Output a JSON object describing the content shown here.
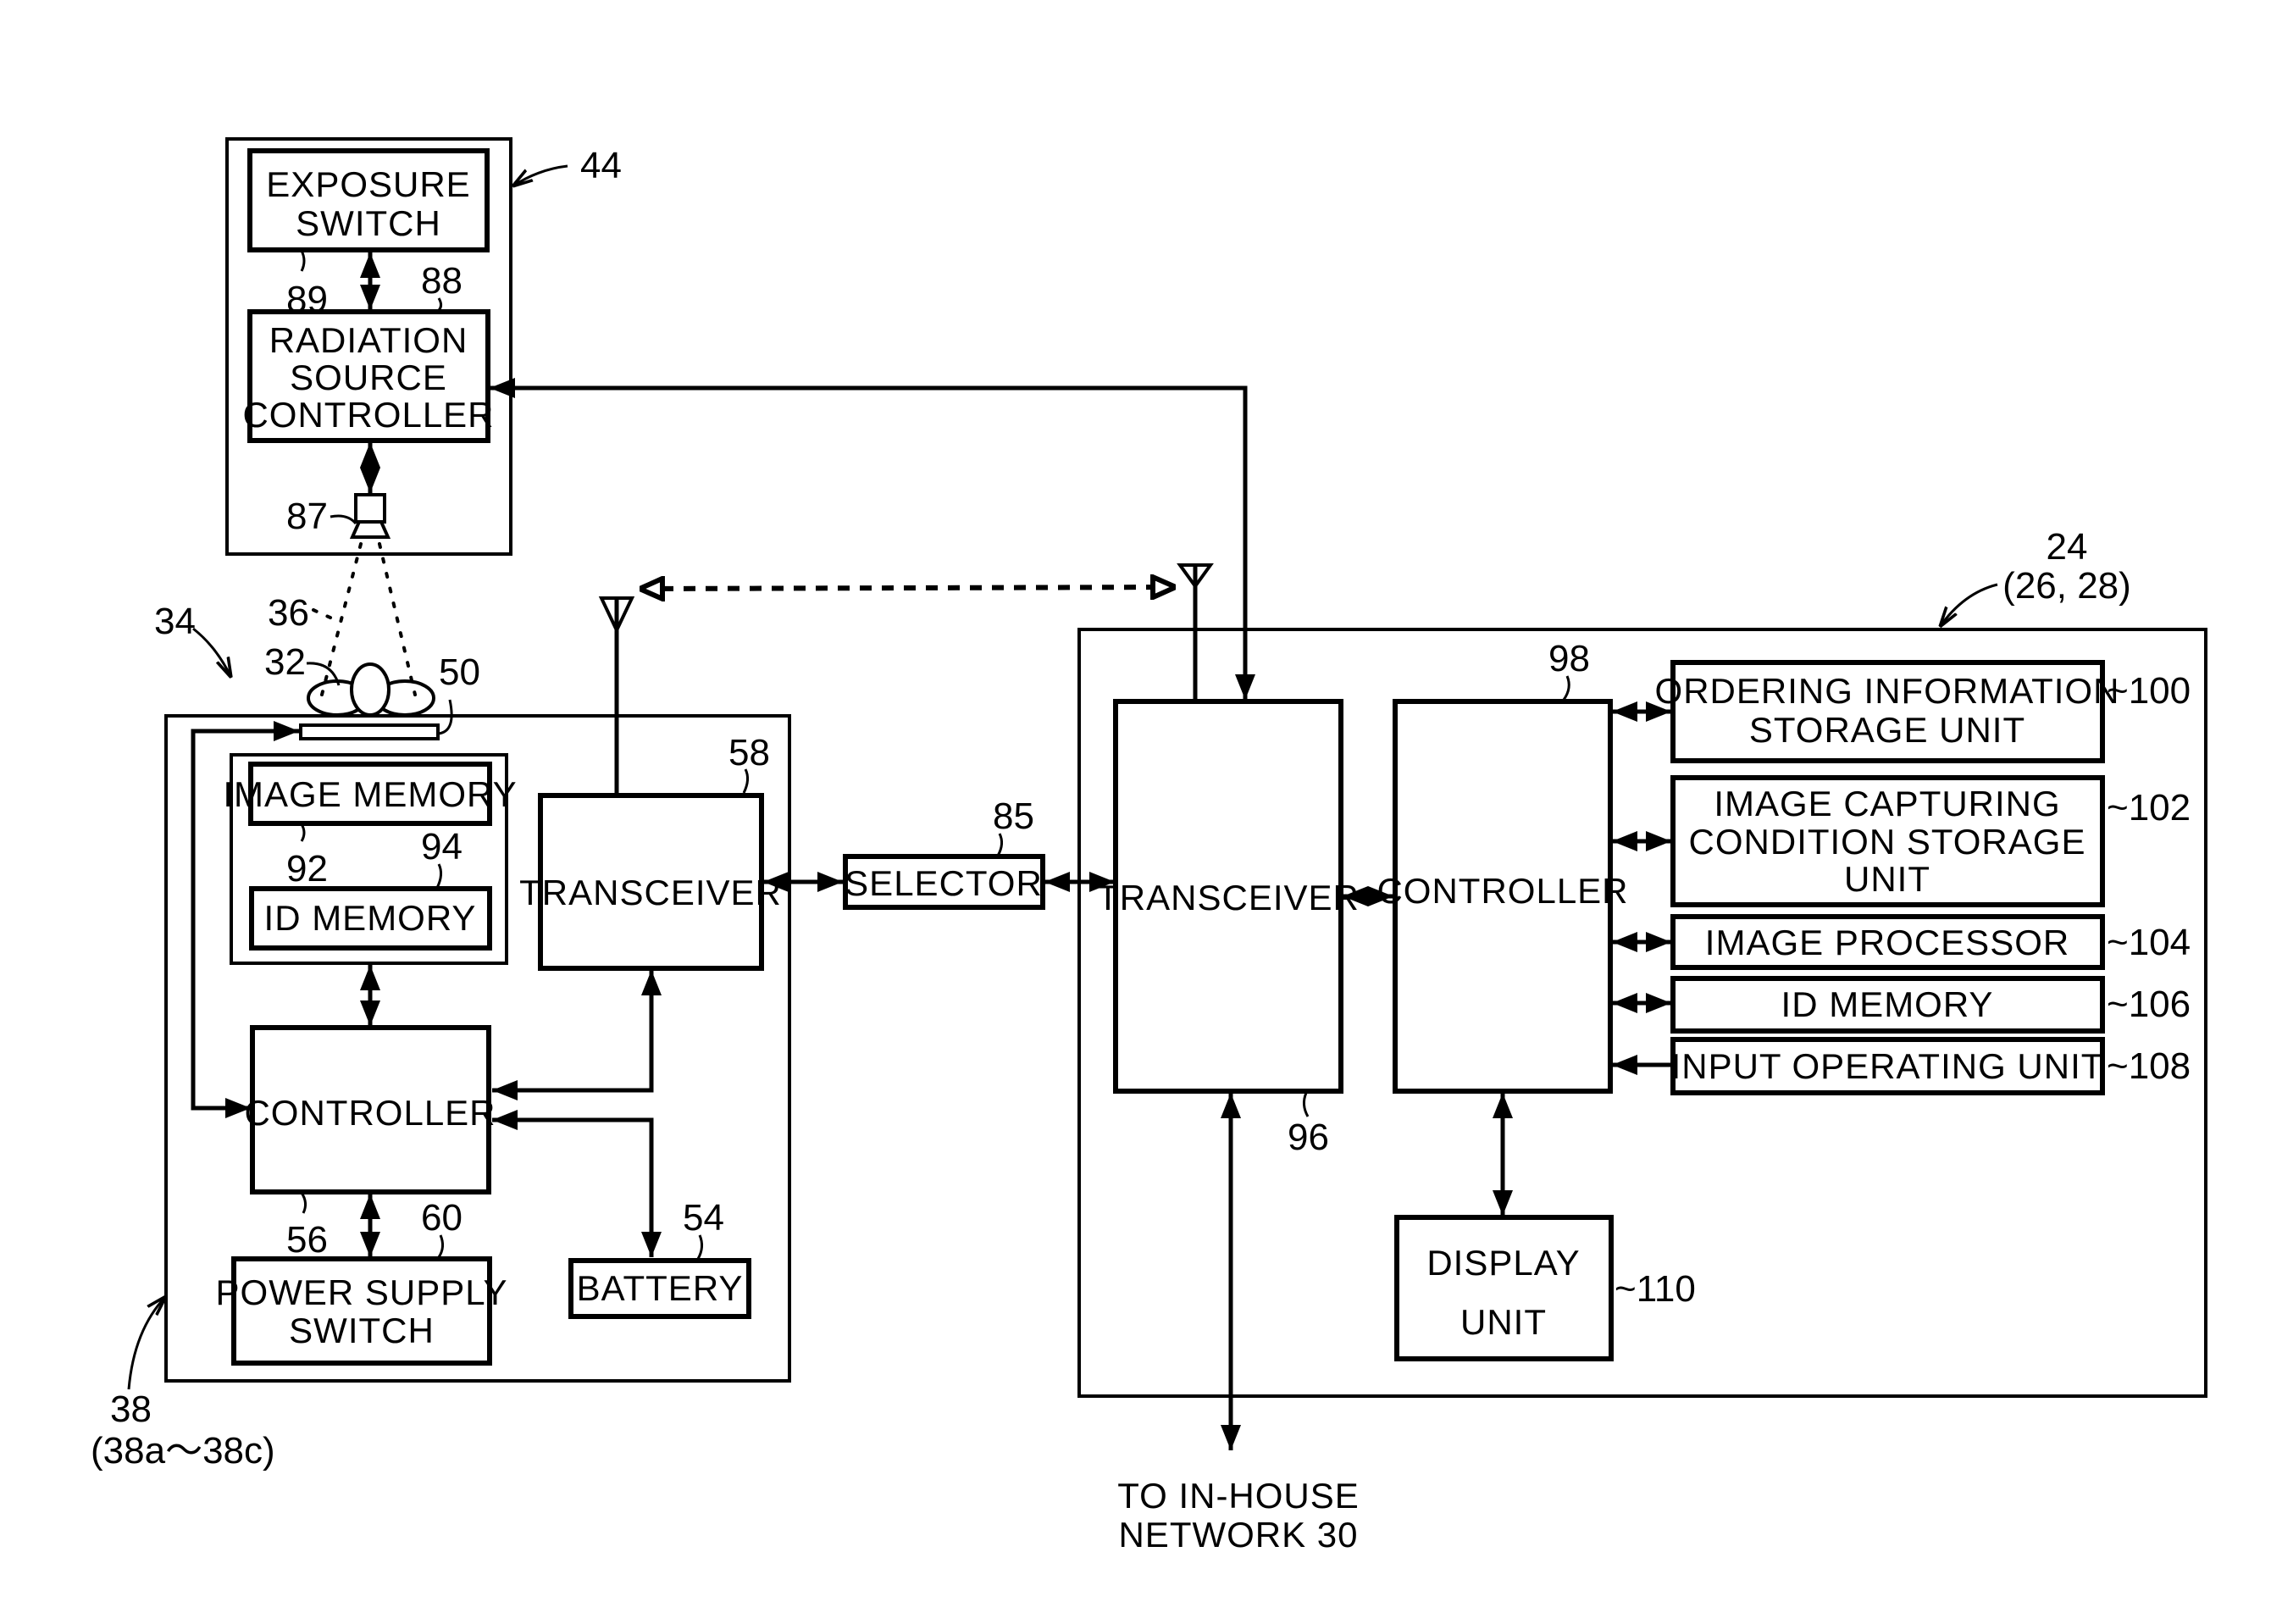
{
  "figure": {
    "colors": {
      "ink": "#000000",
      "paper": "#ffffff"
    },
    "source_unit": {
      "ref": "44",
      "exposure_switch": {
        "lines": [
          "EXPOSURE",
          "SWITCH"
        ],
        "ref": "89"
      },
      "radiation_source_controller": {
        "lines": [
          "RADIATION",
          "SOURCE",
          "CONTROLLER"
        ],
        "ref": "88"
      },
      "radiation_source": {
        "ref": "87"
      }
    },
    "scene": {
      "system_ref": "34",
      "radiation_ref": "36",
      "subject_ref": "32",
      "detector_ref": "50"
    },
    "cassette": {
      "ref": "38",
      "ref_sub": "(38a～38c)",
      "image_memory": {
        "label": "IMAGE MEMORY",
        "ref": "92"
      },
      "id_memory": {
        "label": "ID MEMORY",
        "ref": "94"
      },
      "transceiver": {
        "label": "TRANSCEIVER",
        "ref": "58"
      },
      "controller": {
        "label": "CONTROLLER",
        "ref": "56"
      },
      "power_supply_switch": {
        "lines": [
          "POWER SUPPLY",
          "SWITCH"
        ],
        "ref": "60"
      },
      "battery": {
        "label": "BATTERY",
        "ref": "54"
      }
    },
    "selector": {
      "label": "SELECTOR",
      "ref": "85"
    },
    "console": {
      "ref": "24",
      "ref_sub": "(26, 28)",
      "transceiver": {
        "label": "TRANSCEIVER",
        "ref": "96"
      },
      "controller": {
        "label": "CONTROLLER",
        "ref": "98"
      },
      "ordering_info": {
        "lines": [
          "ORDERING INFORMATION",
          "STORAGE UNIT"
        ],
        "ref": "~100"
      },
      "capture_condition": {
        "lines": [
          "IMAGE CAPTURING",
          "CONDITION STORAGE",
          "UNIT"
        ],
        "ref": "~102"
      },
      "image_processor": {
        "label": "IMAGE PROCESSOR",
        "ref": "~104"
      },
      "id_memory": {
        "label": "ID MEMORY",
        "ref": "~106"
      },
      "input_operating": {
        "label": "INPUT OPERATING UNIT",
        "ref": "~108"
      },
      "display_unit": {
        "lines": [
          "DISPLAY",
          "UNIT"
        ],
        "ref": "~110"
      }
    },
    "network": {
      "lines": [
        "TO IN-HOUSE",
        "NETWORK 30"
      ]
    }
  }
}
